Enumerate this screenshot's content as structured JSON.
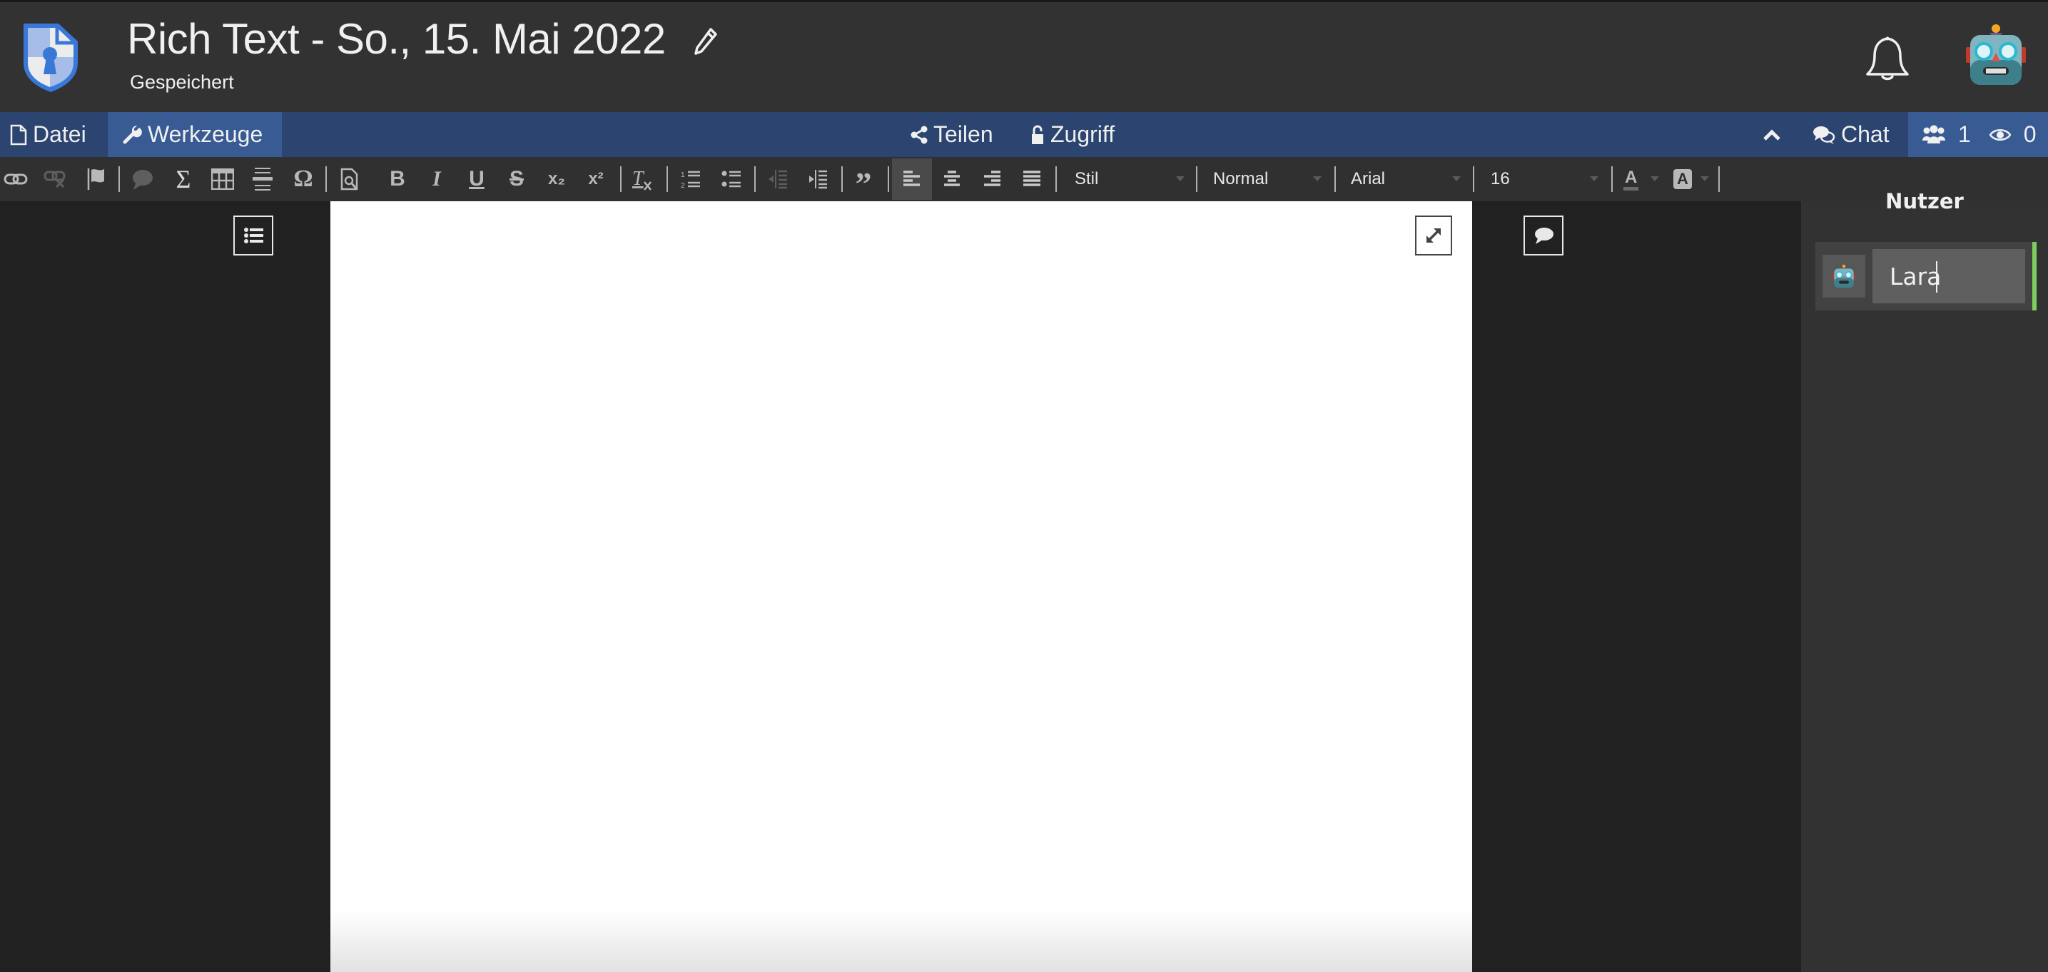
{
  "header": {
    "title": "Rich Text - So., 15. Mai 2022",
    "status": "Gespeichert",
    "logo_icon": "shield-keyhole-document-icon",
    "edit_icon": "pencil-icon",
    "notifications_icon": "bell-icon",
    "user_avatar": "🤖"
  },
  "nav": {
    "tabs": [
      {
        "label": "Datei",
        "icon": "file-icon",
        "active": false
      },
      {
        "label": "Werkzeuge",
        "icon": "wrench-icon",
        "active": true
      }
    ],
    "share_label": "Teilen",
    "access_label": "Zugriff",
    "chat_label": "Chat",
    "users_count": "1",
    "viewers_count": "0"
  },
  "toolbar": {
    "buttons": [
      {
        "name": "link",
        "icon": "link-icon",
        "enabled": true
      },
      {
        "name": "unlink",
        "icon": "unlink-icon",
        "enabled": false
      },
      {
        "name": "anchor",
        "icon": "flag-icon",
        "enabled": true
      },
      {
        "name": "comment",
        "icon": "comment-icon",
        "enabled": false
      },
      {
        "name": "math",
        "icon": "sigma-icon",
        "enabled": true
      },
      {
        "name": "table",
        "icon": "table-icon",
        "enabled": true
      },
      {
        "name": "horizontal-rule",
        "icon": "horizontal-rule-icon",
        "enabled": true
      },
      {
        "name": "special-char",
        "icon": "omega-icon",
        "enabled": true
      },
      {
        "name": "preview",
        "icon": "preview-icon",
        "enabled": true
      },
      {
        "name": "bold",
        "label": "B",
        "enabled": true
      },
      {
        "name": "italic",
        "label": "I",
        "enabled": true
      },
      {
        "name": "underline",
        "label": "U",
        "enabled": true
      },
      {
        "name": "strikethrough",
        "label": "S",
        "enabled": true
      },
      {
        "name": "subscript",
        "label": "x₂",
        "enabled": true
      },
      {
        "name": "superscript",
        "label": "x²",
        "enabled": true
      },
      {
        "name": "remove-format",
        "label": "Tx",
        "enabled": true
      },
      {
        "name": "numbered-list",
        "icon": "ordered-list-icon",
        "enabled": true
      },
      {
        "name": "bulleted-list",
        "icon": "unordered-list-icon",
        "enabled": true
      },
      {
        "name": "outdent",
        "icon": "outdent-icon",
        "enabled": false
      },
      {
        "name": "indent",
        "icon": "indent-icon",
        "enabled": true
      },
      {
        "name": "blockquote",
        "icon": "quote-icon",
        "enabled": true
      },
      {
        "name": "align-left",
        "icon": "align-left-icon",
        "active": true
      },
      {
        "name": "align-center",
        "icon": "align-center-icon"
      },
      {
        "name": "align-right",
        "icon": "align-right-icon"
      },
      {
        "name": "justify",
        "icon": "align-justify-icon"
      }
    ],
    "style_select": "Stil",
    "format_select": "Normal",
    "font_select": "Arial",
    "size_select": "16",
    "text_color_label": "A",
    "bg_color_label": "A"
  },
  "sidebar": {
    "heading": "Nutzer",
    "users": [
      {
        "name": "Lara",
        "avatar": "🤖",
        "status_color": "#7dce5e"
      }
    ]
  },
  "colors": {
    "topbar": "#323232",
    "navbar": "#2b4470",
    "nav_active": "#385b94",
    "toolbar": "#303030",
    "workspace": "#212121",
    "accent_online": "#7dce5e"
  }
}
